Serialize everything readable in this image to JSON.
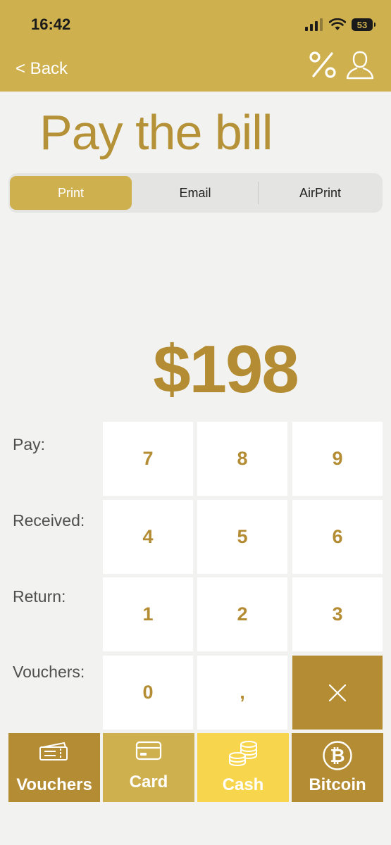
{
  "status_bar": {
    "time": "16:42",
    "battery": "53"
  },
  "nav": {
    "back_label": "< Back",
    "percent_glyph": "%"
  },
  "page": {
    "title": "Pay the bill"
  },
  "segments": [
    {
      "label": "Print",
      "active": true
    },
    {
      "label": "Email",
      "active": false
    },
    {
      "label": "AirPrint",
      "active": false
    }
  ],
  "amount": "$198",
  "labels": {
    "pay": "Pay:",
    "received": "Received:",
    "return": "Return:",
    "vouchers": "Vouchers:"
  },
  "keypad": [
    "7",
    "8",
    "9",
    "4",
    "5",
    "6",
    "1",
    "2",
    "3",
    "0",
    ",",
    "×"
  ],
  "payment_methods": [
    {
      "label": "Vouchers",
      "icon": "ticket-icon",
      "color": "#b48c33"
    },
    {
      "label": "Card",
      "icon": "credit-card-icon",
      "color": "#cfb04e"
    },
    {
      "label": "Cash",
      "icon": "coins-icon",
      "color": "#f7d64e"
    },
    {
      "label": "Bitcoin",
      "icon": "bitcoin-icon",
      "color": "#b48c33"
    }
  ],
  "colors": {
    "header": "#cfb04e",
    "accent": "#b48c33",
    "background": "#f2f3f1"
  }
}
